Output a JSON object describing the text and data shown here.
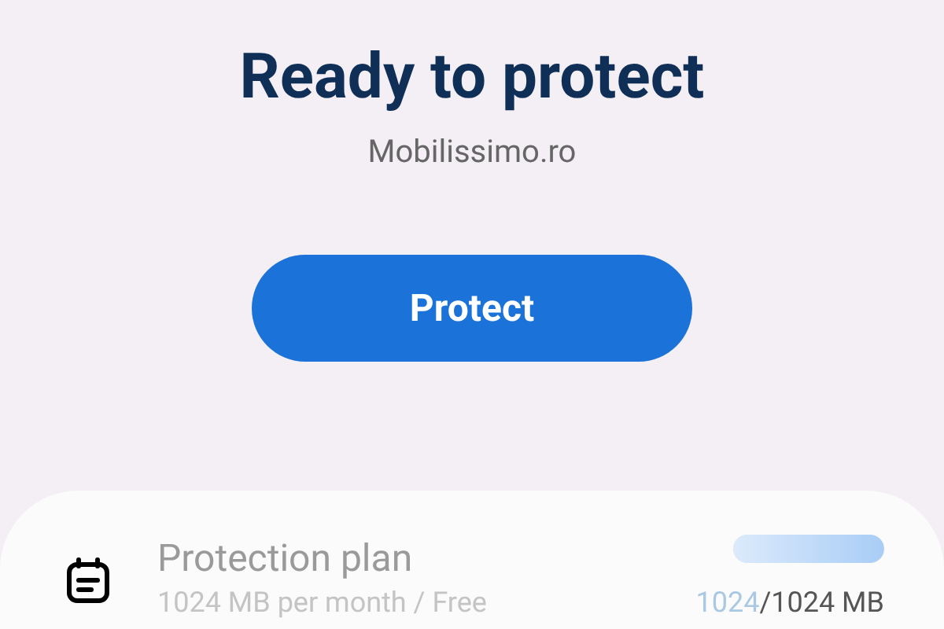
{
  "header": {
    "title": "Ready to protect",
    "network": "Mobilissimo.ro"
  },
  "protect_button": {
    "label": "Protect"
  },
  "plan": {
    "title": "Protection plan",
    "subtitle": "1024 MB per month / Free",
    "disabled": true,
    "level": 1,
    "used": "1024",
    "total": "/1024 MB"
  }
}
